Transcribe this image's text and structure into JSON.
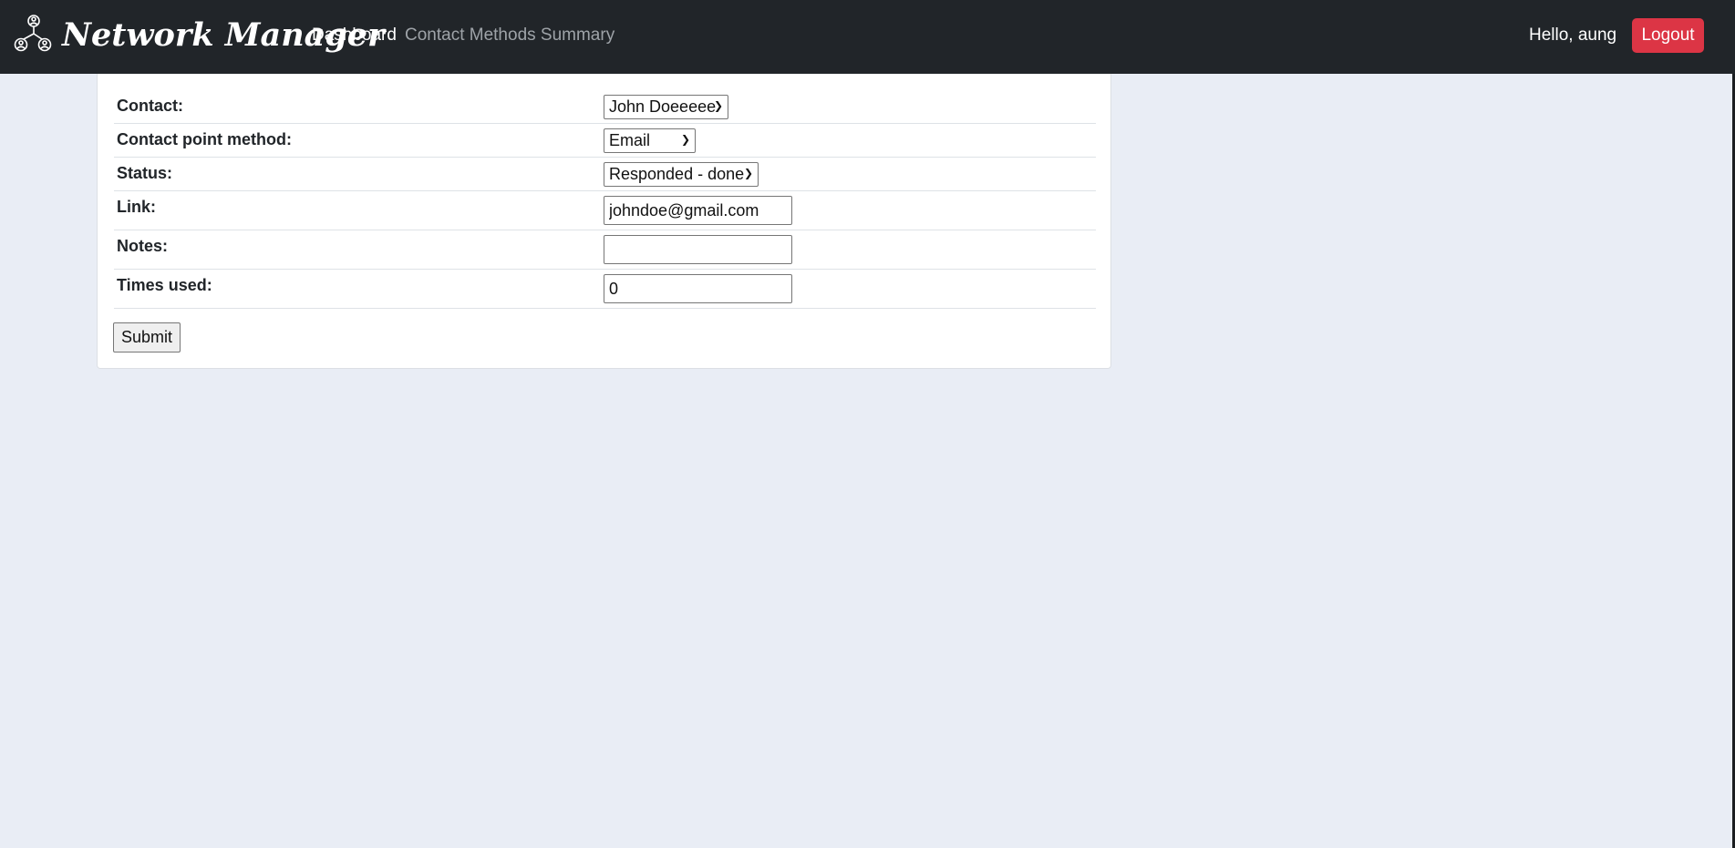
{
  "app": {
    "brand": "Network Manager",
    "brand_logo_icon": "network-people-icon"
  },
  "nav": {
    "dashboard": "Dashboard",
    "summary": "Contact Methods Summary"
  },
  "user": {
    "greeting": "Hello, aung",
    "logout": "Logout"
  },
  "colors": {
    "navbar": "#212529",
    "logout": "#dc3545",
    "background": "#e9edf5"
  },
  "form": {
    "contact": {
      "label": "Contact:",
      "value": "John Doeeeee"
    },
    "method": {
      "label": "Contact point method:",
      "value": "Email"
    },
    "status": {
      "label": "Status:",
      "value": "Responded - done"
    },
    "link": {
      "label": "Link:",
      "value": "johndoe@gmail.com"
    },
    "notes": {
      "label": "Notes:",
      "value": ""
    },
    "times_used": {
      "label": "Times used:",
      "value": "0"
    },
    "submit": "Submit"
  }
}
